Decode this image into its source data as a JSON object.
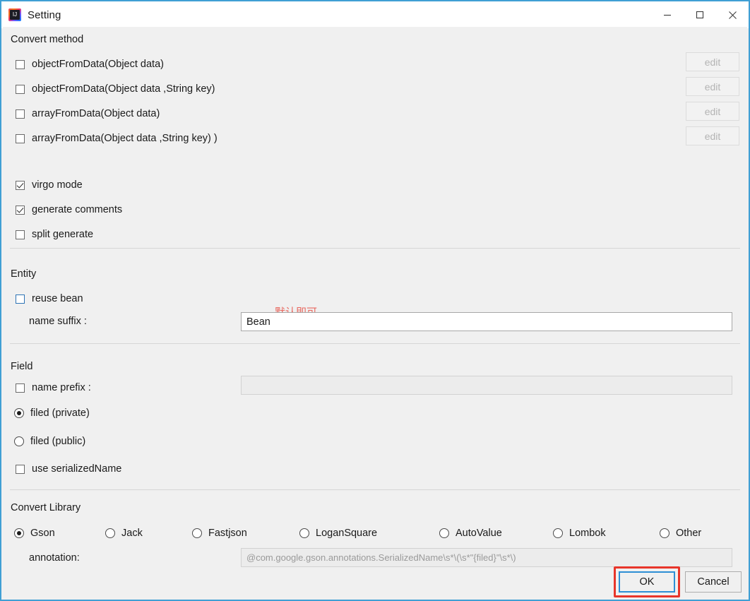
{
  "window": {
    "title": "Setting",
    "icon": "intellij-idea-icon",
    "accent_border": "#3f9fd4",
    "controls": [
      {
        "name": "minimize",
        "glyph": "minimize-icon"
      },
      {
        "name": "maximize",
        "glyph": "maximize-icon"
      },
      {
        "name": "close",
        "glyph": "close-icon"
      }
    ]
  },
  "convert_method": {
    "title": "Convert method",
    "items": [
      {
        "label": "objectFromData(Object data)",
        "checked": false,
        "edit_label": "edit",
        "edit_disabled": true
      },
      {
        "label": "objectFromData(Object data ,String key)",
        "checked": false,
        "edit_label": "edit",
        "edit_disabled": true
      },
      {
        "label": "arrayFromData(Object data)",
        "checked": false,
        "edit_label": "edit",
        "edit_disabled": true
      },
      {
        "label": "arrayFromData(Object data ,String key) )",
        "checked": false,
        "edit_label": "edit",
        "edit_disabled": true
      }
    ],
    "options": [
      {
        "label": "virgo mode",
        "checked": true
      },
      {
        "label": "generate comments",
        "checked": true
      },
      {
        "label": "split generate",
        "checked": false
      }
    ]
  },
  "entity": {
    "title": "Entity",
    "reuse_bean": {
      "label": "reuse bean",
      "checked": false,
      "focused": true
    },
    "name_suffix": {
      "label": "name suffix :",
      "value": "Bean",
      "placeholder": ""
    },
    "annotation_note": "默认即可"
  },
  "field": {
    "title": "Field",
    "name_prefix": {
      "label": "name prefix :",
      "checked": false,
      "value": "",
      "disabled": true
    },
    "radios": [
      {
        "label": "filed (private)",
        "selected": true
      },
      {
        "label": "filed (public)",
        "selected": false
      }
    ],
    "use_serialized_name": {
      "label": "use serializedName",
      "checked": false
    }
  },
  "convert_library": {
    "title": "Convert Library",
    "options": [
      {
        "label": "Gson",
        "selected": true
      },
      {
        "label": "Jack",
        "selected": false
      },
      {
        "label": "Fastjson",
        "selected": false
      },
      {
        "label": "LoganSquare",
        "selected": false
      },
      {
        "label": "AutoValue",
        "selected": false
      },
      {
        "label": "Lombok",
        "selected": false
      },
      {
        "label": "Other",
        "selected": false
      }
    ],
    "annotation": {
      "label": "annotation:",
      "value": "@com.google.gson.annotations.SerializedName\\s*\\(\\s*\"{filed}\"\\s*\\)",
      "disabled": true
    }
  },
  "footer": {
    "ok_label": "OK",
    "cancel_label": "Cancel",
    "ok_highlight_color": "#e8352a"
  }
}
